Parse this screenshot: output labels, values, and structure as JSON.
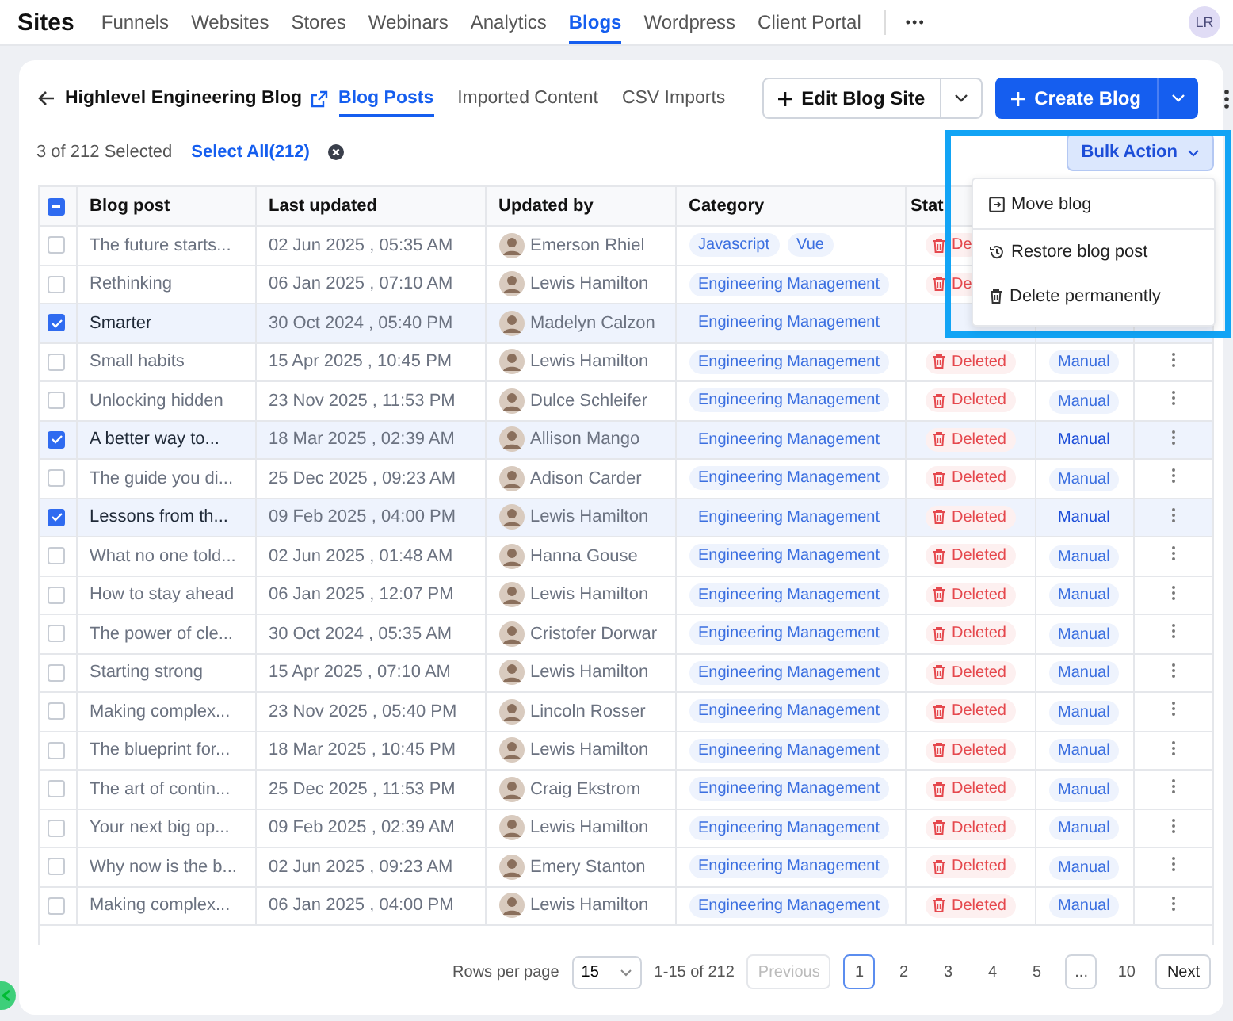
{
  "nav": {
    "title": "Sites",
    "items": [
      {
        "label": "Funnels",
        "selected": false
      },
      {
        "label": "Websites",
        "selected": false
      },
      {
        "label": "Stores",
        "selected": false
      },
      {
        "label": "Webinars",
        "selected": false
      },
      {
        "label": "Analytics",
        "selected": false
      },
      {
        "label": "Blogs",
        "selected": true
      },
      {
        "label": "Wordpress",
        "selected": false
      },
      {
        "label": "Client Portal",
        "selected": false
      }
    ],
    "more": "•••",
    "avatar": "LR"
  },
  "header": {
    "blog_name": "Highlevel Engineering Blog",
    "tabs": [
      {
        "label": "Blog Posts",
        "selected": true
      },
      {
        "label": "Imported Content",
        "selected": false
      },
      {
        "label": "CSV Imports",
        "selected": false
      }
    ],
    "edit_button": "Edit Blog Site",
    "create_button": "Create Blog"
  },
  "selection": {
    "summary": "3 of 212 Selected",
    "select_all": "Select All(212)"
  },
  "bulk_action": {
    "label": "Bulk Action",
    "menu": [
      {
        "kind": "move",
        "label": "Move blog"
      },
      {
        "kind": "restore",
        "label": "Restore blog post"
      },
      {
        "kind": "delete",
        "label": "Delete permanently"
      }
    ]
  },
  "table": {
    "header_checked": true,
    "header_partial": true,
    "columns": [
      "Blog post",
      "Last updated",
      "Updated by",
      "Category",
      "Stat"
    ],
    "rows": [
      {
        "selected": false,
        "title": "The future starts...",
        "updated": "02 Jun 2025 , 05:35 AM",
        "by": "Emerson Rhiel",
        "categories": [
          "Javascript",
          "Vue"
        ],
        "status": "De"
      },
      {
        "selected": false,
        "title": "Rethinking",
        "updated": "06 Jan 2025 , 07:10 AM",
        "by": "Lewis Hamilton",
        "categories": [
          "Engineering Management"
        ],
        "status": "De"
      },
      {
        "selected": true,
        "title": "Smarter",
        "updated": "30 Oct 2024 , 05:40 PM",
        "by": "Madelyn Calzon",
        "categories": [
          "Engineering Management"
        ]
      },
      {
        "selected": false,
        "title": "Small habits",
        "updated": "15 Apr 2025 , 10:45 PM",
        "by": "Lewis Hamilton",
        "categories": [
          "Engineering Management"
        ],
        "status": "Deleted",
        "type": "Manual"
      },
      {
        "selected": false,
        "title": "Unlocking hidden",
        "updated": "23 Nov 2025 , 11:53 PM",
        "by": "Dulce Schleifer",
        "categories": [
          "Engineering Management"
        ],
        "status": "Deleted",
        "type": "Manual"
      },
      {
        "selected": true,
        "title": "A better way to...",
        "updated": "18 Mar 2025 , 02:39 AM",
        "by": "Allison Mango",
        "categories": [
          "Engineering Management"
        ],
        "status": "Deleted",
        "type": "Manual"
      },
      {
        "selected": false,
        "title": "The guide you di...",
        "updated": "25 Dec 2025 , 09:23 AM",
        "by": "Adison Carder",
        "categories": [
          "Engineering Management"
        ],
        "status": "Deleted",
        "type": "Manual"
      },
      {
        "selected": true,
        "title": "Lessons from th...",
        "updated": "09 Feb 2025 , 04:00 PM",
        "by": "Lewis Hamilton",
        "categories": [
          "Engineering Management"
        ],
        "status": "Deleted",
        "type": "Manual"
      },
      {
        "selected": false,
        "title": "What no one told...",
        "updated": "02 Jun 2025 , 01:48 AM",
        "by": "Hanna Gouse",
        "categories": [
          "Engineering Management"
        ],
        "status": "Deleted",
        "type": "Manual"
      },
      {
        "selected": false,
        "title": "How to stay ahead",
        "updated": "06 Jan 2025 , 12:07 PM",
        "by": "Lewis Hamilton",
        "categories": [
          "Engineering Management"
        ],
        "status": "Deleted",
        "type": "Manual"
      },
      {
        "selected": false,
        "title": "The power of cle...",
        "updated": "30 Oct 2024 , 05:35 AM",
        "by": "Cristofer Dorwar",
        "categories": [
          "Engineering Management"
        ],
        "status": "Deleted",
        "type": "Manual"
      },
      {
        "selected": false,
        "title": "Starting strong",
        "updated": "15 Apr 2025 , 07:10 AM",
        "by": "Lewis Hamilton",
        "categories": [
          "Engineering Management"
        ],
        "status": "Deleted",
        "type": "Manual"
      },
      {
        "selected": false,
        "title": "Making complex...",
        "updated": "23 Nov 2025 , 05:40 PM",
        "by": "Lincoln Rosser",
        "categories": [
          "Engineering Management"
        ],
        "status": "Deleted",
        "type": "Manual"
      },
      {
        "selected": false,
        "title": "The blueprint for...",
        "updated": "18 Mar 2025 , 10:45 PM",
        "by": "Lewis Hamilton",
        "categories": [
          "Engineering Management"
        ],
        "status": "Deleted",
        "type": "Manual"
      },
      {
        "selected": false,
        "title": "The art of contin...",
        "updated": "25 Dec 2025 , 11:53 PM",
        "by": "Craig Ekstrom",
        "categories": [
          "Engineering Management"
        ],
        "status": "Deleted",
        "type": "Manual"
      },
      {
        "selected": false,
        "title": "Your next big op...",
        "updated": "09 Feb 2025 , 02:39 AM",
        "by": "Lewis Hamilton",
        "categories": [
          "Engineering Management"
        ],
        "status": "Deleted",
        "type": "Manual"
      },
      {
        "selected": false,
        "title": "Why now is the b...",
        "updated": "02 Jun 2025 , 09:23 AM",
        "by": "Emery Stanton",
        "categories": [
          "Engineering Management"
        ],
        "status": "Deleted",
        "type": "Manual"
      },
      {
        "selected": false,
        "title": "Making complex...",
        "updated": "06 Jan 2025 , 04:00 PM",
        "by": "Lewis Hamilton",
        "categories": [
          "Engineering Management"
        ],
        "status": "Deleted",
        "type": "Manual"
      }
    ]
  },
  "pagination": {
    "rows_label": "Rows per page",
    "rows_value": "15",
    "range": "1-15 of 212",
    "previous": {
      "label": "Previous",
      "disabled": true
    },
    "pages": [
      {
        "kind": "page",
        "label": "1",
        "selected": true
      },
      {
        "kind": "page",
        "label": "2",
        "selected": false
      },
      {
        "kind": "page",
        "label": "3",
        "selected": false
      },
      {
        "kind": "page",
        "label": "4",
        "selected": false
      },
      {
        "kind": "page",
        "label": "5",
        "selected": false
      },
      {
        "kind": "gap",
        "label": "...",
        "selected": false
      },
      {
        "kind": "page",
        "label": "10",
        "selected": false
      }
    ],
    "next": {
      "label": "Next",
      "disabled": false
    }
  }
}
